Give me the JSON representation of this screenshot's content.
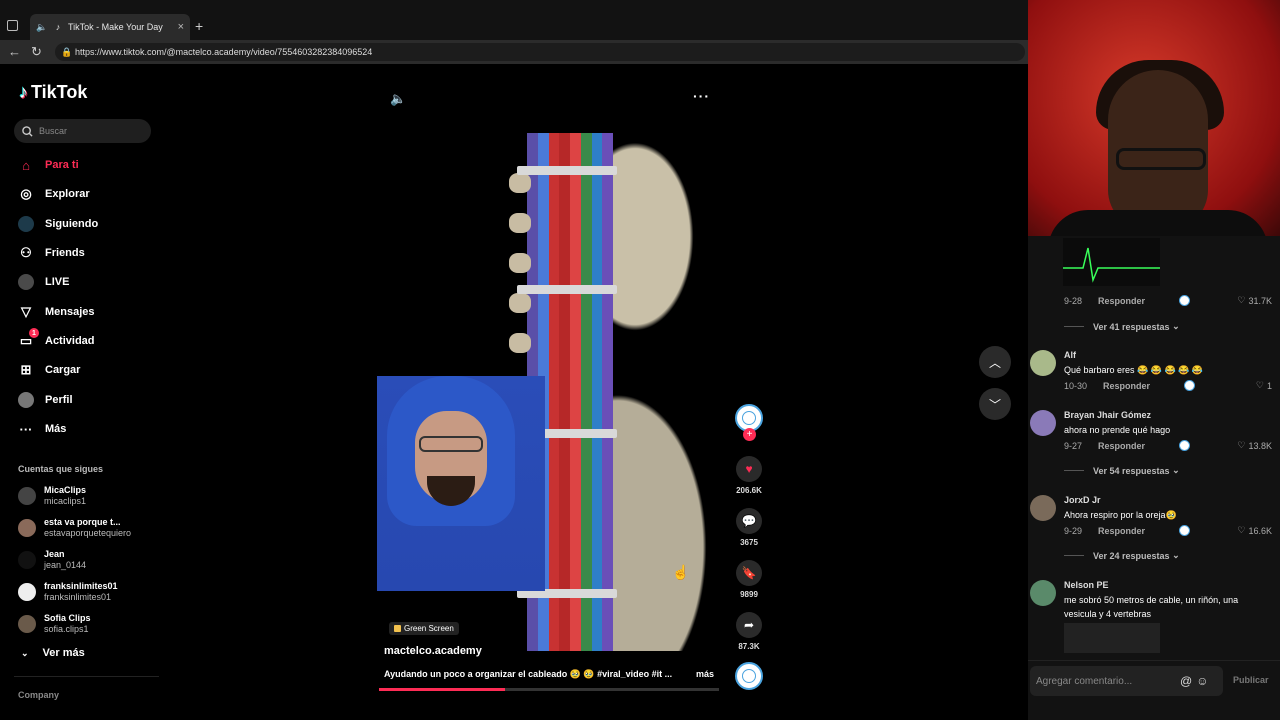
{
  "browser": {
    "tab_title": "TikTok - Make Your Day",
    "url": "https://www.tiktok.com/@mactelco.academy/video/7554603282384096524"
  },
  "sidebar": {
    "brand": "TikTok",
    "search_placeholder": "Buscar",
    "nav": [
      {
        "label": "Para ti",
        "icon": "home-icon"
      },
      {
        "label": "Explorar",
        "icon": "compass-icon"
      },
      {
        "label": "Siguiendo",
        "icon": "following-icon"
      },
      {
        "label": "Friends",
        "icon": "friends-icon"
      },
      {
        "label": "LIVE",
        "icon": "live-icon"
      },
      {
        "label": "Mensajes",
        "icon": "message-icon"
      },
      {
        "label": "Actividad",
        "icon": "activity-icon",
        "badge": "1"
      },
      {
        "label": "Cargar",
        "icon": "upload-icon"
      },
      {
        "label": "Perfil",
        "icon": "profile-icon"
      },
      {
        "label": "Más",
        "icon": "more-icon"
      }
    ],
    "following_title": "Cuentas que sigues",
    "following": [
      {
        "name": "MicaClips",
        "handle": "micaclips1"
      },
      {
        "name": "esta va porque t...",
        "handle": "estavaporquetequiero"
      },
      {
        "name": "Jean",
        "handle": "jean_0144"
      },
      {
        "name": "franksinlimites01",
        "handle": "franksinlimites01"
      },
      {
        "name": "Sofia Clips",
        "handle": "sofia.clips1"
      }
    ],
    "see_more": "Ver más",
    "company": "Company"
  },
  "video": {
    "tag": "Green Screen",
    "author": "mactelco.academy",
    "description": "Ayudando un poco a organizar el cableado 🥹 🥹 #viral_video #it ...",
    "more": "más",
    "progress": 0.37
  },
  "actions": {
    "likes": "206.6K",
    "comments": "3675",
    "saves": "9899",
    "shares": "87.3K"
  },
  "comments_panel": {
    "top_meta": {
      "date": "9-28",
      "reply": "Responder",
      "likes": "31.7K"
    },
    "top_replies": "Ver 41 respuestas",
    "items": [
      {
        "name": "Alf",
        "text": "Qué barbaro eres 😂 😂 😂 😂 😂",
        "date": "10-30",
        "reply": "Responder",
        "likes": "1"
      },
      {
        "name": "Brayan Jhair Gómez",
        "text": "ahora no prende qué hago",
        "date": "9-27",
        "reply": "Responder",
        "likes": "13.8K",
        "replies": "Ver 54 respuestas"
      },
      {
        "name": "JorxD Jr",
        "text": "Ahora respiro por la oreja🥹",
        "date": "9-29",
        "reply": "Responder",
        "likes": "16.6K",
        "replies": "Ver 24 respuestas"
      },
      {
        "name": "Nelson PE",
        "text": "me sobró 50 metros de cable, un riñón, una vesicula y 4 vertebras"
      }
    ],
    "input_placeholder": "Agregar comentario...",
    "publish": "Publicar"
  }
}
